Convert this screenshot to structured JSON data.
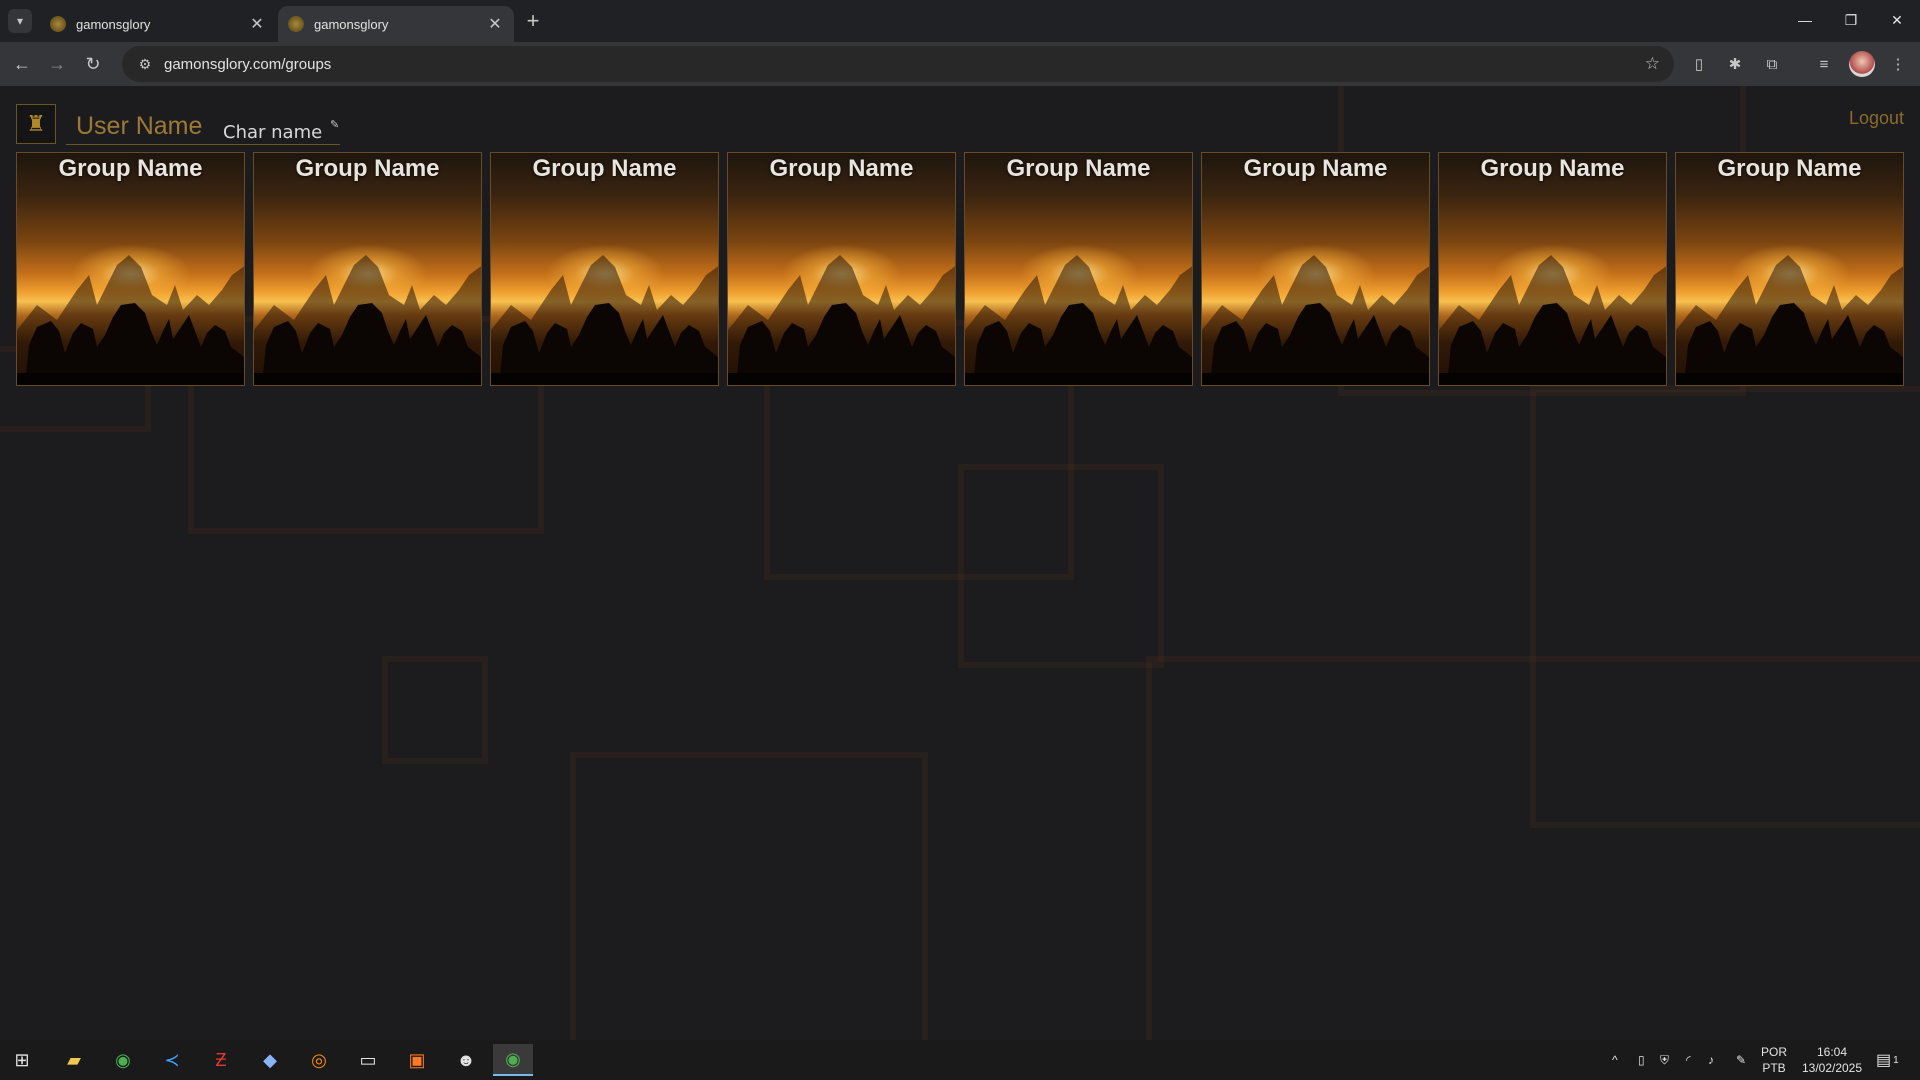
{
  "browser": {
    "tabs": [
      {
        "title": "gamonsglory"
      },
      {
        "title": "gamonsglory"
      }
    ],
    "url": "gamonsglory.com/groups"
  },
  "page": {
    "user_name": "User Name",
    "char_name": "Char name",
    "logout_label": "Logout",
    "groups": [
      {
        "name": "Group Name"
      },
      {
        "name": "Group Name"
      },
      {
        "name": "Group Name"
      },
      {
        "name": "Group Name"
      },
      {
        "name": "Group Name"
      },
      {
        "name": "Group Name"
      },
      {
        "name": "Group Name"
      },
      {
        "name": "Group Name"
      }
    ]
  },
  "taskbar": {
    "language_line1": "POR",
    "language_line2": "PTB",
    "time": "16:04",
    "date": "13/02/2025",
    "notification_count": "1"
  },
  "colors": {
    "background": "#1c1b1e",
    "accent_gold": "#9c7a35",
    "card_border": "#6b4a26"
  }
}
